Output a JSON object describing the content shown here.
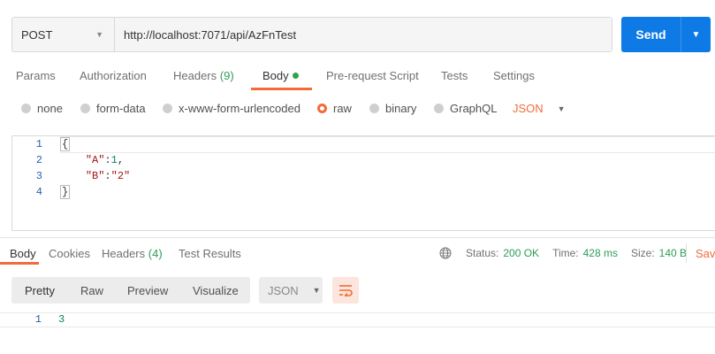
{
  "request": {
    "method": "POST",
    "url": "http://localhost:7071/api/AzFnTest",
    "send_label": "Send"
  },
  "request_tabs": [
    {
      "label": "Params"
    },
    {
      "label": "Authorization"
    },
    {
      "label": "Headers",
      "count": "(9)"
    },
    {
      "label": "Body"
    },
    {
      "label": "Pre-request Script"
    },
    {
      "label": "Tests"
    },
    {
      "label": "Settings"
    }
  ],
  "body_types": [
    "none",
    "form-data",
    "x-www-form-urlencoded",
    "raw",
    "binary",
    "GraphQL"
  ],
  "body_format": "JSON",
  "editor": {
    "line_numbers": [
      "1",
      "2",
      "3",
      "4"
    ],
    "lines": [
      "{",
      "    \"A\":1,",
      "    \"B\":\"2\"",
      "}"
    ],
    "key_a": "\"A\"",
    "val_a": "1",
    "key_b": "\"B\"",
    "val_b": "\"2\"",
    "open_brace": "{",
    "close_brace": "}"
  },
  "response_tabs": [
    {
      "label": "Body"
    },
    {
      "label": "Cookies"
    },
    {
      "label": "Headers",
      "count": "(4)"
    },
    {
      "label": "Test Results"
    }
  ],
  "status": {
    "status_label": "Status:",
    "status_value": "200 OK",
    "time_label": "Time:",
    "time_value": "428 ms",
    "size_label": "Size:",
    "size_value": "140 B",
    "save_label": "Save"
  },
  "view_modes": [
    "Pretty",
    "Raw",
    "Preview",
    "Visualize"
  ],
  "response_format": "JSON",
  "response": {
    "line_number": "1",
    "content": "3"
  },
  "colors": {
    "accent": "#f26b3a",
    "send": "#0e7ae6",
    "success": "#2e9c57"
  }
}
